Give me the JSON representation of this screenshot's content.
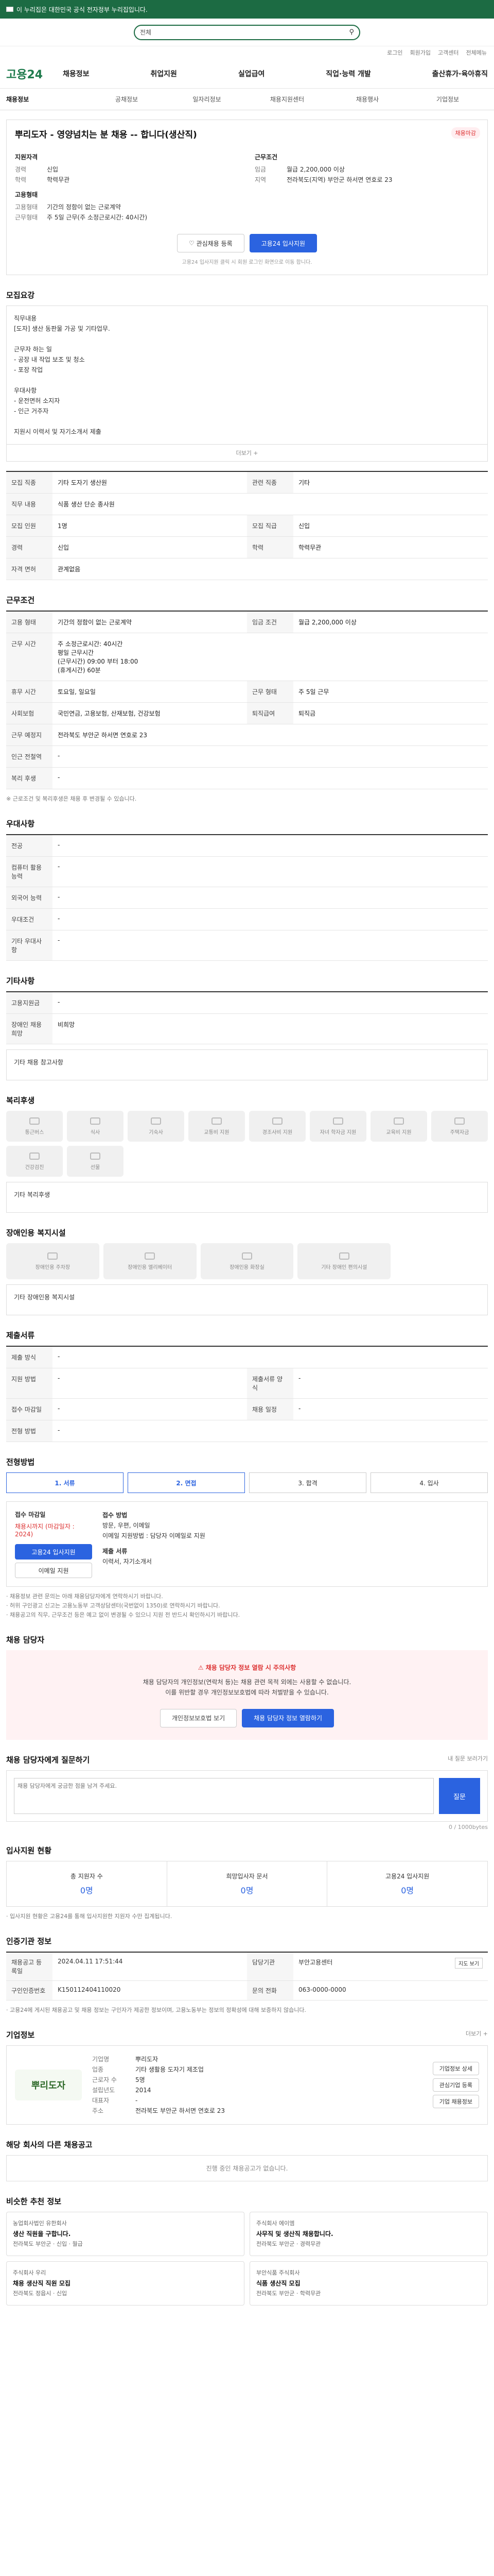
{
  "topbar": {
    "text": "이 누리집은 대한민국 공식 전자정부 누리집입니다."
  },
  "search": {
    "select": "전체",
    "placeholder": ""
  },
  "util": [
    "로그인",
    "회원가입",
    "고객센터",
    "전체메뉴"
  ],
  "gnb": {
    "logo": "고용24",
    "menu": [
      "채용정보",
      "취업지원",
      "실업급여",
      "직업·능력 개발",
      "출산휴가·육아휴직"
    ]
  },
  "sub": [
    "채용정보",
    "공채정보",
    "일자리정보",
    "채용지원센터",
    "채용행사",
    "기업정보"
  ],
  "job": {
    "title": "뿌리도자 - 영양넘치는 분 채용 -- 합니다(생산직)",
    "badge": "채용마감",
    "left_hd": "지원자격",
    "left": [
      {
        "k": "경력",
        "v": "신입"
      },
      {
        "k": "학력",
        "v": "학력무관"
      }
    ],
    "left2_hd": "고용형태",
    "left2": [
      {
        "k": "고용형태",
        "v": "기간의 정함이 없는 근로계약"
      },
      {
        "k": "근무형태",
        "v": "주 5일 근무(주 소정근로시간: 40시간)"
      }
    ],
    "right_hd": "근무조건",
    "right": [
      {
        "k": "임금",
        "v": "월급 2,200,000 이상"
      },
      {
        "k": "지역",
        "v": "전라북도(지역) 부안군 하서면 연호로 23"
      }
    ],
    "btn1": "관심채용 등록",
    "btn2": "고용24 입사지원",
    "note": "고용24 입사지원 클릭 시 회원 로그인 화면으로 이동 합니다."
  },
  "recruit": {
    "title": "모집요강",
    "desc": "직무내용\n[도자] 생산 동판물 가공 및 기타업무.\n\n근무자 하는 일\n- 공장 내 작업 보조 및 청소\n- 포장 작업\n\n우대사항\n- 운전면허 소지자\n- 인근 거주자\n\n지원시 이력서 및 자기소개서 제출",
    "more": "더보기 +",
    "rows": [
      {
        "k": "모집 직종",
        "v": "기타 도자기 생산원",
        "k2": "관련 직종",
        "v2": "기타"
      },
      {
        "k": "직무 내용",
        "v": "식품 생산 단순 종사원",
        "k2": "",
        "v2": ""
      },
      {
        "k": "모집 인원",
        "v": "1명",
        "k2": "모집 직급",
        "v2": "신입"
      },
      {
        "k": "경력",
        "v": "신입",
        "k2": "학력",
        "v2": "학력무관"
      },
      {
        "k": "자격 면허",
        "v": "관계없음",
        "k2": "",
        "v2": ""
      }
    ]
  },
  "work": {
    "title": "근무조건",
    "rows": [
      {
        "k": "고용 형태",
        "v": "기간의 정함이 없는 근로계약",
        "k2": "임금 조건",
        "v2": "월급 2,200,000 이상"
      },
      {
        "k": "근무 시간",
        "v": "주 소정근로시간: 40시간\n평일 근무시간\n(근무시간) 09:00 부터 18:00\n(휴게시간) 60분",
        "k2": "",
        "v2": ""
      },
      {
        "k": "휴무 시간",
        "v": "토요일, 일요일",
        "k2": "근무 형태",
        "v2": "주 5일 근무"
      },
      {
        "k": "사회보험",
        "v": "국민연금, 고용보험, 산재보험, 건강보험",
        "k2": "퇴직급여",
        "v2": "퇴직금"
      },
      {
        "k": "근무 예정지",
        "v": "전라북도 부안군 하서면 연호로 23",
        "k2": "",
        "v2": ""
      },
      {
        "k": "인근 전철역",
        "v": "-",
        "k2": "",
        "v2": ""
      },
      {
        "k": "복리 후생",
        "v": "-",
        "k2": "",
        "v2": ""
      }
    ],
    "note": "※ 근로조건 및 복리후생은 채용 후 변경될 수 있습니다.",
    "map_btn": "지도 보기"
  },
  "prefer": {
    "title": "우대사항",
    "rows": [
      {
        "k": "전공",
        "v": "-"
      },
      {
        "k": "컴퓨터 활용 능력",
        "v": "-"
      },
      {
        "k": "외국어 능력",
        "v": "-"
      },
      {
        "k": "우대조건",
        "v": "-"
      },
      {
        "k": "기타 우대사항",
        "v": "-"
      }
    ]
  },
  "etc": {
    "title": "기타사항",
    "rows": [
      {
        "k": "고용지원금",
        "v": "-"
      },
      {
        "k": "장애인 채용 희망",
        "v": "비희망"
      }
    ],
    "detail": "기타 채용 참고사항"
  },
  "welfare": {
    "title": "복리후생",
    "items": [
      "통근버스",
      "식사",
      "기숙사",
      "교통비 지원",
      "경조사비 지원",
      "자녀 학자금 지원",
      "교육비 지원",
      "주택자금",
      "건강검진",
      "선물"
    ],
    "detail": "기타 복리후생"
  },
  "disabled": {
    "title": "장애인용 복지시설",
    "items": [
      "장애인용 주차장",
      "장애인용 엘리베이터",
      "장애인용 화장실",
      "기타 장애인 편의시설"
    ],
    "detail": "기타 장애인용 복지시설"
  },
  "materials": {
    "title": "제출서류",
    "rows": [
      {
        "k": "제출 방식",
        "v": "-",
        "k2": "",
        "v2": ""
      },
      {
        "k": "지원 방법",
        "v": "-",
        "k2": "제출서류 양식",
        "v2": "-"
      },
      {
        "k": "접수 마감일",
        "v": "-",
        "k2": "채용 일정",
        "v2": "-"
      },
      {
        "k": "전형 방법",
        "v": "-",
        "k2": "",
        "v2": ""
      }
    ]
  },
  "process": {
    "title": "전형방법",
    "steps": [
      "1. 서류",
      "2. 면접",
      "3. 합격",
      "4. 입사"
    ]
  },
  "howto": {
    "l_hd": "접수 마감일",
    "l": "채용시까지 (마감일자 : 2024)",
    "l_btn": "고용24 입사지원",
    "l_btn2": "이메일 지원",
    "r_hd": "접수 방법",
    "r": "방문, 우편, 이메일\n이메일 지원방법 : 담당자 이메일로 지원",
    "r2_hd": "제출 서류",
    "r2": "이력서, 자기소개서",
    "bullets": [
      "· 채용정보 관련 문의는 아래 채용담당자에게 연락하시기 바랍니다.",
      "· 허위 구인광고 신고는 고용노동부 고객상담센터(국번없이 1350)로 연락하시기 바랍니다.",
      "· 채용공고의 직무, 근무조건 등은 예고 없이 변경될 수 있으니 지원 전 반드시 확인하시기 바랍니다."
    ]
  },
  "manager": {
    "title": "채용 담당자",
    "box_hd": "채용 담당자 정보 열람 시 주의사항",
    "box": "채용 담당자의 개인정보(연락처 등)는 채용 관련 목적 외에는 사용할 수 없습니다.\n이를 위반할 경우 개인정보보호법에 따라 처벌받을 수 있습니다.",
    "btn1": "개인정보보호법 보기",
    "btn2": "채용 담당자 정보 열람하기"
  },
  "qa": {
    "title": "채용 담당자에게 질문하기",
    "limit": "0 / 1000bytes",
    "placeholder": "채용 담당자에게 궁금한 점을 남겨 주세요.",
    "submit": "질문",
    "more": "내 질문 보러가기"
  },
  "stats": {
    "title": "입사지원 현황",
    "items": [
      {
        "label": "총 지원자 수",
        "num": "0명"
      },
      {
        "label": "희망입사자 문서",
        "num": "0명"
      },
      {
        "label": "고용24 입사지원",
        "num": "0명"
      }
    ],
    "note": "· 입사지원 현황은 고용24를 통해 입사지원한 지원자 수만 집계됩니다."
  },
  "regdate": {
    "title": "인증기관 정보",
    "rows": [
      {
        "k": "채용공고 등록일",
        "v": "2024.04.11 17:51:44",
        "k2": "담당기관",
        "v2": "부안고용센터"
      },
      {
        "k": "구인인증번호",
        "v": "K150112404110020",
        "k2": "문의 전화",
        "v2": "063-0000-0000"
      }
    ],
    "btn": "지도 보기",
    "note": "· 고용24에 게시된 채용공고 및 채용 정보는 구인자가 제공한 정보이며, 고용노동부는 정보의 정확성에 대해 보증하지 않습니다."
  },
  "company": {
    "title": "기업정보",
    "more": "더보기 +",
    "logo": "뿌리도자",
    "rows": [
      {
        "k": "기업명",
        "v": "뿌리도자"
      },
      {
        "k": "업종",
        "v": "기타 생활용 도자기 제조업"
      },
      {
        "k": "근로자 수",
        "v": "5명"
      },
      {
        "k": "설립년도",
        "v": "2014"
      },
      {
        "k": "대표자",
        "v": "-"
      },
      {
        "k": "주소",
        "v": "전라북도 부안군 하서면 연호로 23"
      }
    ],
    "btns": [
      "기업정보 상세",
      "관심기업 등록",
      "기업 채용정보"
    ]
  },
  "other": {
    "title": "해당 회사의 다른 채용공고",
    "empty": "진행 중인 채용공고가 없습니다."
  },
  "similar": {
    "title": "비슷한 추천 정보",
    "cards": [
      {
        "co": "농업회사법인 유한회사",
        "t": "생산 직원을 구합니다.",
        "s": "전라북도 부안군 · 신입 · 월급"
      },
      {
        "co": "주식회사 에이엠",
        "t": "사무직 및 생산직 채용합니다.",
        "s": "전라북도 부안군 · 경력무관"
      },
      {
        "co": "주식회사 우리",
        "t": "채용 생산직 직원 모집",
        "s": "전라북도 정읍시 · 신입"
      },
      {
        "co": "부안식품 주식회사",
        "t": "식품 생산직 모집",
        "s": "전라북도 부안군 · 학력무관"
      }
    ]
  }
}
